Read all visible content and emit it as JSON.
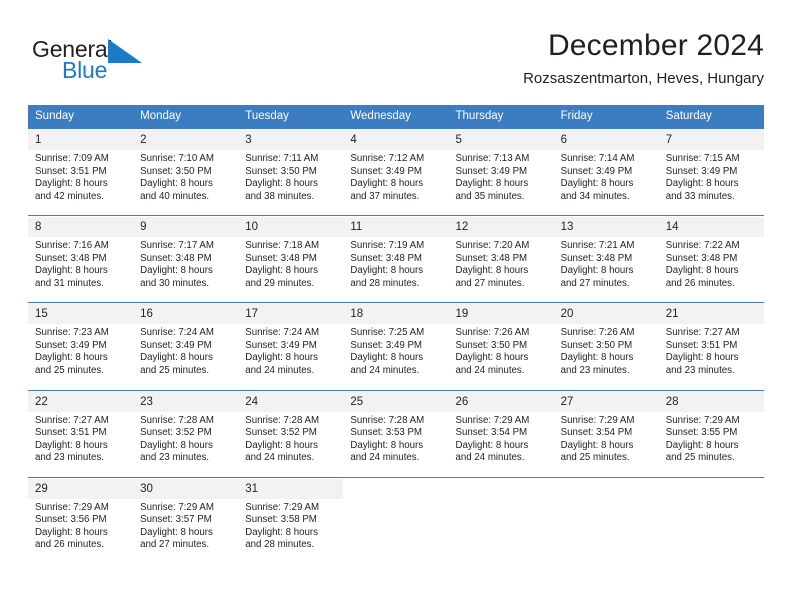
{
  "brand": {
    "name_part1": "General",
    "name_part2": "Blue",
    "mark_color": "#1c7bc6",
    "text_color": "#231f20"
  },
  "header": {
    "title": "December 2024",
    "subtitle": "Rozsaszentmarton, Heves, Hungary",
    "accent_color": "#3b7dc0",
    "daynum_band_color": "#f2f2f2"
  },
  "weekdays": [
    "Sunday",
    "Monday",
    "Tuesday",
    "Wednesday",
    "Thursday",
    "Friday",
    "Saturday"
  ],
  "weeks": [
    {
      "days": [
        {
          "date": "1",
          "sunrise": "Sunrise: 7:09 AM",
          "sunset": "Sunset: 3:51 PM",
          "daylight1": "Daylight: 8 hours",
          "daylight2": "and 42 minutes."
        },
        {
          "date": "2",
          "sunrise": "Sunrise: 7:10 AM",
          "sunset": "Sunset: 3:50 PM",
          "daylight1": "Daylight: 8 hours",
          "daylight2": "and 40 minutes."
        },
        {
          "date": "3",
          "sunrise": "Sunrise: 7:11 AM",
          "sunset": "Sunset: 3:50 PM",
          "daylight1": "Daylight: 8 hours",
          "daylight2": "and 38 minutes."
        },
        {
          "date": "4",
          "sunrise": "Sunrise: 7:12 AM",
          "sunset": "Sunset: 3:49 PM",
          "daylight1": "Daylight: 8 hours",
          "daylight2": "and 37 minutes."
        },
        {
          "date": "5",
          "sunrise": "Sunrise: 7:13 AM",
          "sunset": "Sunset: 3:49 PM",
          "daylight1": "Daylight: 8 hours",
          "daylight2": "and 35 minutes."
        },
        {
          "date": "6",
          "sunrise": "Sunrise: 7:14 AM",
          "sunset": "Sunset: 3:49 PM",
          "daylight1": "Daylight: 8 hours",
          "daylight2": "and 34 minutes."
        },
        {
          "date": "7",
          "sunrise": "Sunrise: 7:15 AM",
          "sunset": "Sunset: 3:49 PM",
          "daylight1": "Daylight: 8 hours",
          "daylight2": "and 33 minutes."
        }
      ]
    },
    {
      "days": [
        {
          "date": "8",
          "sunrise": "Sunrise: 7:16 AM",
          "sunset": "Sunset: 3:48 PM",
          "daylight1": "Daylight: 8 hours",
          "daylight2": "and 31 minutes."
        },
        {
          "date": "9",
          "sunrise": "Sunrise: 7:17 AM",
          "sunset": "Sunset: 3:48 PM",
          "daylight1": "Daylight: 8 hours",
          "daylight2": "and 30 minutes."
        },
        {
          "date": "10",
          "sunrise": "Sunrise: 7:18 AM",
          "sunset": "Sunset: 3:48 PM",
          "daylight1": "Daylight: 8 hours",
          "daylight2": "and 29 minutes."
        },
        {
          "date": "11",
          "sunrise": "Sunrise: 7:19 AM",
          "sunset": "Sunset: 3:48 PM",
          "daylight1": "Daylight: 8 hours",
          "daylight2": "and 28 minutes."
        },
        {
          "date": "12",
          "sunrise": "Sunrise: 7:20 AM",
          "sunset": "Sunset: 3:48 PM",
          "daylight1": "Daylight: 8 hours",
          "daylight2": "and 27 minutes."
        },
        {
          "date": "13",
          "sunrise": "Sunrise: 7:21 AM",
          "sunset": "Sunset: 3:48 PM",
          "daylight1": "Daylight: 8 hours",
          "daylight2": "and 27 minutes."
        },
        {
          "date": "14",
          "sunrise": "Sunrise: 7:22 AM",
          "sunset": "Sunset: 3:48 PM",
          "daylight1": "Daylight: 8 hours",
          "daylight2": "and 26 minutes."
        }
      ]
    },
    {
      "days": [
        {
          "date": "15",
          "sunrise": "Sunrise: 7:23 AM",
          "sunset": "Sunset: 3:49 PM",
          "daylight1": "Daylight: 8 hours",
          "daylight2": "and 25 minutes."
        },
        {
          "date": "16",
          "sunrise": "Sunrise: 7:24 AM",
          "sunset": "Sunset: 3:49 PM",
          "daylight1": "Daylight: 8 hours",
          "daylight2": "and 25 minutes."
        },
        {
          "date": "17",
          "sunrise": "Sunrise: 7:24 AM",
          "sunset": "Sunset: 3:49 PM",
          "daylight1": "Daylight: 8 hours",
          "daylight2": "and 24 minutes."
        },
        {
          "date": "18",
          "sunrise": "Sunrise: 7:25 AM",
          "sunset": "Sunset: 3:49 PM",
          "daylight1": "Daylight: 8 hours",
          "daylight2": "and 24 minutes."
        },
        {
          "date": "19",
          "sunrise": "Sunrise: 7:26 AM",
          "sunset": "Sunset: 3:50 PM",
          "daylight1": "Daylight: 8 hours",
          "daylight2": "and 24 minutes."
        },
        {
          "date": "20",
          "sunrise": "Sunrise: 7:26 AM",
          "sunset": "Sunset: 3:50 PM",
          "daylight1": "Daylight: 8 hours",
          "daylight2": "and 23 minutes."
        },
        {
          "date": "21",
          "sunrise": "Sunrise: 7:27 AM",
          "sunset": "Sunset: 3:51 PM",
          "daylight1": "Daylight: 8 hours",
          "daylight2": "and 23 minutes."
        }
      ]
    },
    {
      "days": [
        {
          "date": "22",
          "sunrise": "Sunrise: 7:27 AM",
          "sunset": "Sunset: 3:51 PM",
          "daylight1": "Daylight: 8 hours",
          "daylight2": "and 23 minutes."
        },
        {
          "date": "23",
          "sunrise": "Sunrise: 7:28 AM",
          "sunset": "Sunset: 3:52 PM",
          "daylight1": "Daylight: 8 hours",
          "daylight2": "and 23 minutes."
        },
        {
          "date": "24",
          "sunrise": "Sunrise: 7:28 AM",
          "sunset": "Sunset: 3:52 PM",
          "daylight1": "Daylight: 8 hours",
          "daylight2": "and 24 minutes."
        },
        {
          "date": "25",
          "sunrise": "Sunrise: 7:28 AM",
          "sunset": "Sunset: 3:53 PM",
          "daylight1": "Daylight: 8 hours",
          "daylight2": "and 24 minutes."
        },
        {
          "date": "26",
          "sunrise": "Sunrise: 7:29 AM",
          "sunset": "Sunset: 3:54 PM",
          "daylight1": "Daylight: 8 hours",
          "daylight2": "and 24 minutes."
        },
        {
          "date": "27",
          "sunrise": "Sunrise: 7:29 AM",
          "sunset": "Sunset: 3:54 PM",
          "daylight1": "Daylight: 8 hours",
          "daylight2": "and 25 minutes."
        },
        {
          "date": "28",
          "sunrise": "Sunrise: 7:29 AM",
          "sunset": "Sunset: 3:55 PM",
          "daylight1": "Daylight: 8 hours",
          "daylight2": "and 25 minutes."
        }
      ]
    },
    {
      "days": [
        {
          "date": "29",
          "sunrise": "Sunrise: 7:29 AM",
          "sunset": "Sunset: 3:56 PM",
          "daylight1": "Daylight: 8 hours",
          "daylight2": "and 26 minutes."
        },
        {
          "date": "30",
          "sunrise": "Sunrise: 7:29 AM",
          "sunset": "Sunset: 3:57 PM",
          "daylight1": "Daylight: 8 hours",
          "daylight2": "and 27 minutes."
        },
        {
          "date": "31",
          "sunrise": "Sunrise: 7:29 AM",
          "sunset": "Sunset: 3:58 PM",
          "daylight1": "Daylight: 8 hours",
          "daylight2": "and 28 minutes."
        },
        {
          "date": "",
          "sunrise": "",
          "sunset": "",
          "daylight1": "",
          "daylight2": ""
        },
        {
          "date": "",
          "sunrise": "",
          "sunset": "",
          "daylight1": "",
          "daylight2": ""
        },
        {
          "date": "",
          "sunrise": "",
          "sunset": "",
          "daylight1": "",
          "daylight2": ""
        },
        {
          "date": "",
          "sunrise": "",
          "sunset": "",
          "daylight1": "",
          "daylight2": ""
        }
      ]
    }
  ]
}
